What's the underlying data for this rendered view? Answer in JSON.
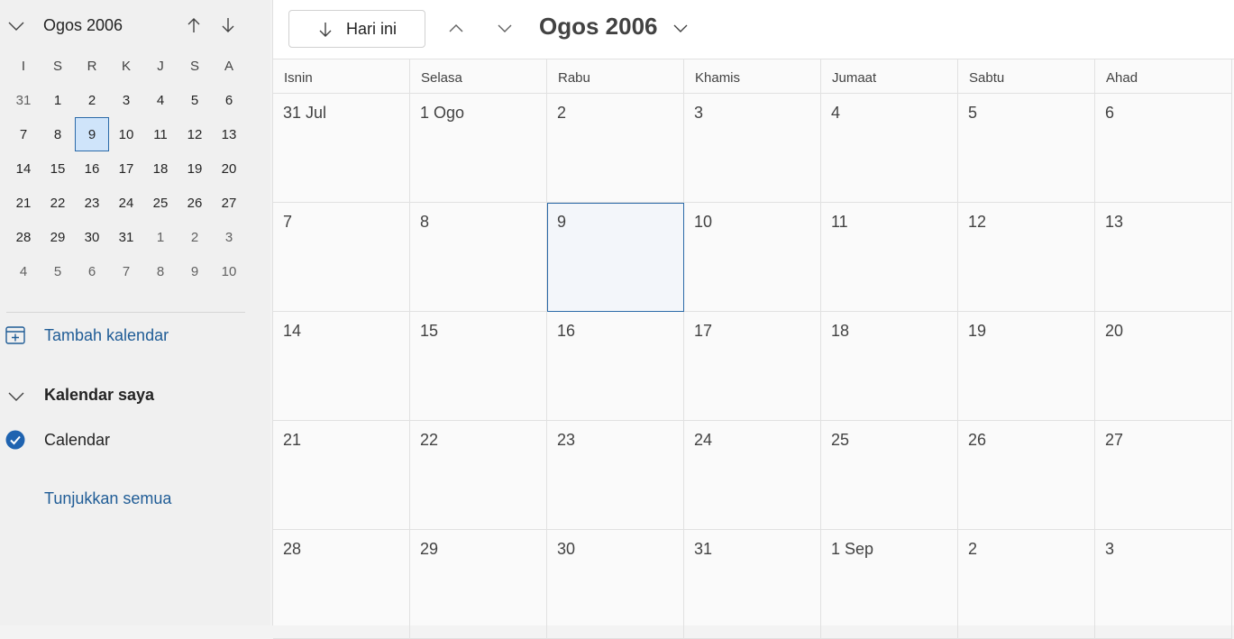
{
  "sidebar": {
    "mini_calendar": {
      "title": "Ogos 2006",
      "weekdays": [
        "I",
        "S",
        "R",
        "K",
        "J",
        "S",
        "A"
      ],
      "weeks": [
        [
          {
            "d": "31",
            "other": true
          },
          {
            "d": "1"
          },
          {
            "d": "2"
          },
          {
            "d": "3"
          },
          {
            "d": "4"
          },
          {
            "d": "5"
          },
          {
            "d": "6"
          }
        ],
        [
          {
            "d": "7"
          },
          {
            "d": "8"
          },
          {
            "d": "9",
            "selected": true
          },
          {
            "d": "10"
          },
          {
            "d": "11"
          },
          {
            "d": "12"
          },
          {
            "d": "13"
          }
        ],
        [
          {
            "d": "14"
          },
          {
            "d": "15"
          },
          {
            "d": "16"
          },
          {
            "d": "17"
          },
          {
            "d": "18"
          },
          {
            "d": "19"
          },
          {
            "d": "20"
          }
        ],
        [
          {
            "d": "21"
          },
          {
            "d": "22"
          },
          {
            "d": "23"
          },
          {
            "d": "24"
          },
          {
            "d": "25"
          },
          {
            "d": "26"
          },
          {
            "d": "27"
          }
        ],
        [
          {
            "d": "28"
          },
          {
            "d": "29"
          },
          {
            "d": "30"
          },
          {
            "d": "31"
          },
          {
            "d": "1",
            "other": true
          },
          {
            "d": "2",
            "other": true
          },
          {
            "d": "3",
            "other": true
          }
        ],
        [
          {
            "d": "4",
            "other": true
          },
          {
            "d": "5",
            "other": true
          },
          {
            "d": "6",
            "other": true
          },
          {
            "d": "7",
            "other": true
          },
          {
            "d": "8",
            "other": true
          },
          {
            "d": "9",
            "other": true
          },
          {
            "d": "10",
            "other": true
          }
        ]
      ]
    },
    "add_calendar_label": "Tambah kalendar",
    "my_calendars_title": "Kalendar saya",
    "calendar_item_label": "Calendar",
    "show_all_label": "Tunjukkan semua"
  },
  "toolbar": {
    "today_label": "Hari ini",
    "month_title": "Ogos 2006"
  },
  "month_grid": {
    "weekdays": [
      "Isnin",
      "Selasa",
      "Rabu",
      "Khamis",
      "Jumaat",
      "Sabtu",
      "Ahad"
    ],
    "weeks": [
      [
        {
          "label": "31 Jul"
        },
        {
          "label": "1 Ogo"
        },
        {
          "label": "2"
        },
        {
          "label": "3"
        },
        {
          "label": "4"
        },
        {
          "label": "5"
        },
        {
          "label": "6"
        }
      ],
      [
        {
          "label": "7"
        },
        {
          "label": "8"
        },
        {
          "label": "9",
          "today": true
        },
        {
          "label": "10"
        },
        {
          "label": "11"
        },
        {
          "label": "12"
        },
        {
          "label": "13"
        }
      ],
      [
        {
          "label": "14"
        },
        {
          "label": "15"
        },
        {
          "label": "16"
        },
        {
          "label": "17"
        },
        {
          "label": "18"
        },
        {
          "label": "19"
        },
        {
          "label": "20"
        }
      ],
      [
        {
          "label": "21"
        },
        {
          "label": "22"
        },
        {
          "label": "23"
        },
        {
          "label": "24"
        },
        {
          "label": "25"
        },
        {
          "label": "26"
        },
        {
          "label": "27"
        }
      ],
      [
        {
          "label": "28"
        },
        {
          "label": "29"
        },
        {
          "label": "30"
        },
        {
          "label": "31"
        },
        {
          "label": "1 Sep"
        },
        {
          "label": "2"
        },
        {
          "label": "3"
        }
      ]
    ]
  },
  "colors": {
    "accent": "#2b6aa8",
    "link": "#1f5c96",
    "selected_fill": "#cfe4fa",
    "check_fill": "#1f63b0"
  }
}
